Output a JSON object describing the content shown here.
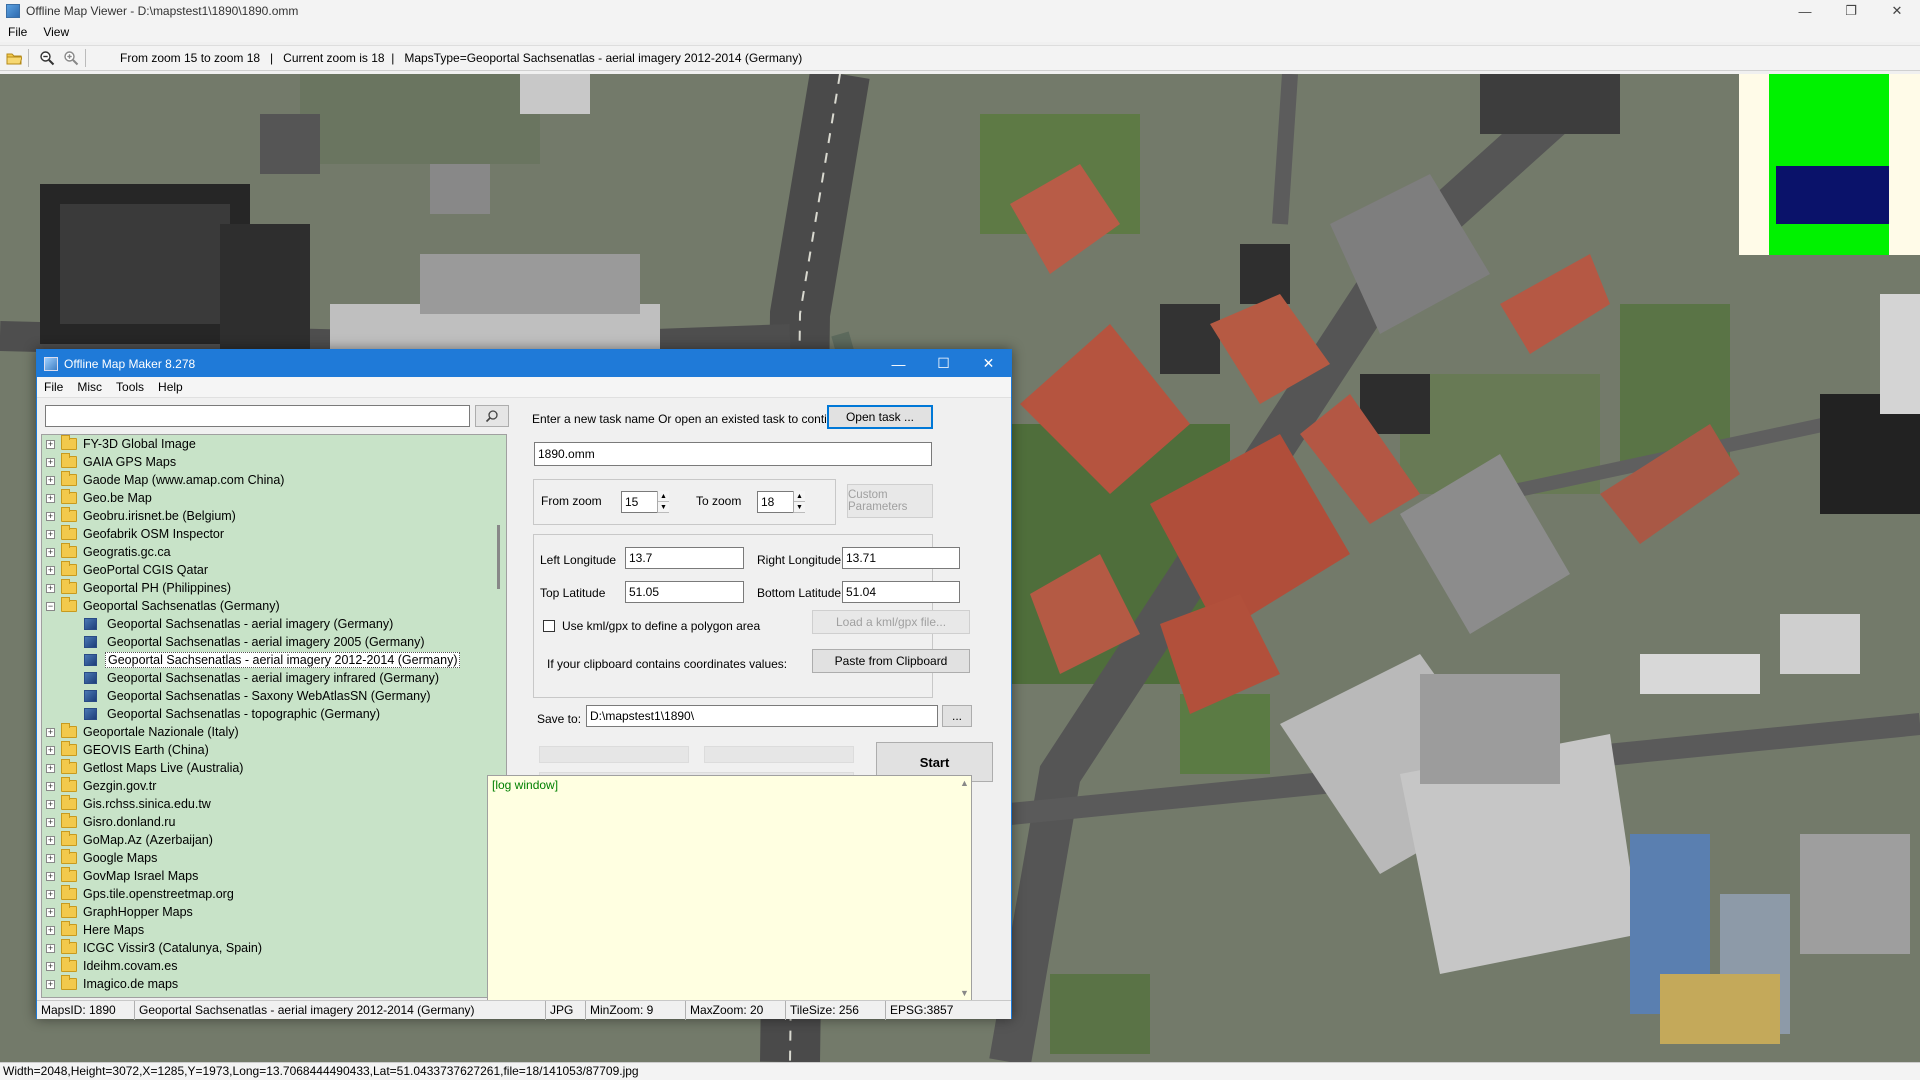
{
  "viewer": {
    "title": "Offline Map Viewer - D:\\mapstest1\\1890\\1890.omm",
    "menu": [
      "File",
      "View"
    ],
    "toolbar_info": "From zoom 15 to zoom 18   |   Current zoom is 18  |   MapsType=Geoportal Sachsenatlas - aerial imagery 2012-2014 (Germany)",
    "status": "Width=2048,Height=3072,X=1285,Y=1973,Long=13.7068444490433,Lat=51.0433737627261,file=18/141053/87709.jpg",
    "controls": {
      "minimize": "—",
      "restore": "❐",
      "close": "✕"
    }
  },
  "dialog": {
    "title": "Offline Map Maker 8.278",
    "menu": [
      "File",
      "Misc",
      "Tools",
      "Help"
    ],
    "search": {
      "value": "",
      "icon": "search-icon"
    },
    "tree": [
      {
        "label": "FY-3D Global Image",
        "expanded": false
      },
      {
        "label": "GAIA GPS Maps",
        "expanded": false
      },
      {
        "label": "Gaode Map (www.amap.com China)",
        "expanded": false
      },
      {
        "label": "Geo.be Map",
        "expanded": false
      },
      {
        "label": "Geobru.irisnet.be (Belgium)",
        "expanded": false
      },
      {
        "label": "Geofabrik OSM Inspector",
        "expanded": false
      },
      {
        "label": "Geogratis.gc.ca",
        "expanded": false
      },
      {
        "label": "GeoPortal CGIS Qatar",
        "expanded": false
      },
      {
        "label": "Geoportal PH (Philippines)",
        "expanded": false
      },
      {
        "label": "Geoportal Sachsenatlas (Germany)",
        "expanded": true,
        "children": [
          {
            "label": "Geoportal Sachsenatlas - aerial imagery (Germany)"
          },
          {
            "label": "Geoportal Sachsenatlas - aerial imagery 2005 (Germany)"
          },
          {
            "label": "Geoportal Sachsenatlas - aerial imagery 2012-2014 (Germany)",
            "selected": true
          },
          {
            "label": "Geoportal Sachsenatlas - aerial imagery infrared (Germany)"
          },
          {
            "label": "Geoportal Sachsenatlas - Saxony WebAtlasSN (Germany)"
          },
          {
            "label": "Geoportal Sachsenatlas - topographic (Germany)"
          }
        ]
      },
      {
        "label": "Geoportale Nazionale (Italy)",
        "expanded": false
      },
      {
        "label": "GEOVIS Earth (China)",
        "expanded": false
      },
      {
        "label": "Getlost Maps Live (Australia)",
        "expanded": false
      },
      {
        "label": "Gezgin.gov.tr",
        "expanded": false
      },
      {
        "label": "Gis.rchss.sinica.edu.tw",
        "expanded": false
      },
      {
        "label": "Gisro.donland.ru",
        "expanded": false
      },
      {
        "label": "GoMap.Az (Azerbaijan)",
        "expanded": false
      },
      {
        "label": "Google Maps",
        "expanded": false
      },
      {
        "label": "GovMap Israel Maps",
        "expanded": false
      },
      {
        "label": "Gps.tile.openstreetmap.org",
        "expanded": false
      },
      {
        "label": "GraphHopper Maps",
        "expanded": false
      },
      {
        "label": "Here Maps",
        "expanded": false
      },
      {
        "label": "ICGC Vissir3 (Catalunya, Spain)",
        "expanded": false
      },
      {
        "label": "Ideihm.covam.es",
        "expanded": false
      },
      {
        "label": "Imagico.de maps",
        "expanded": false
      }
    ],
    "task_prompt": "Enter a new task name Or open an existed task to continue:",
    "open_task_label": "Open task ...",
    "task_name": "1890.omm",
    "from_zoom_label": "From zoom",
    "from_zoom": "15",
    "to_zoom_label": "To zoom",
    "to_zoom": "18",
    "custom_params_label": "Custom Parameters",
    "left_lon_label": "Left Longitude",
    "left_lon": "13.7",
    "right_lon_label": "Right Longitude",
    "right_lon": "13.71",
    "top_lat_label": "Top Latitude",
    "top_lat": "51.05",
    "bottom_lat_label": "Bottom Latitude",
    "bottom_lat": "51.04",
    "kml_label": "Use kml/gpx to define a polygon area",
    "kml_button": "Load a kml/gpx file...",
    "clipboard_prompt": "If your clipboard contains coordinates values:",
    "clipboard_button": "Paste from Clipboard",
    "save_to_label": "Save to:",
    "save_to": "D:\\mapstest1\\1890\\",
    "browse_label": "...",
    "start_label": "Start",
    "log_text": "[log window]",
    "status": {
      "maps_id": "MapsID: 1890",
      "maps_name": "Geoportal Sachsenatlas - aerial imagery 2012-2014 (Germany)",
      "format": "JPG",
      "min_zoom": "MinZoom: 9",
      "max_zoom": "MaxZoom: 20",
      "tile_size": "TileSize: 256",
      "epsg": "EPSG:3857"
    }
  },
  "colors": {
    "dialog_title": "#1f7ad8",
    "tree_bg": "#c8e3c8",
    "log_bg": "#ffffe1",
    "minimap_green": "#00f200",
    "minimap_blue": "#0a126a"
  }
}
